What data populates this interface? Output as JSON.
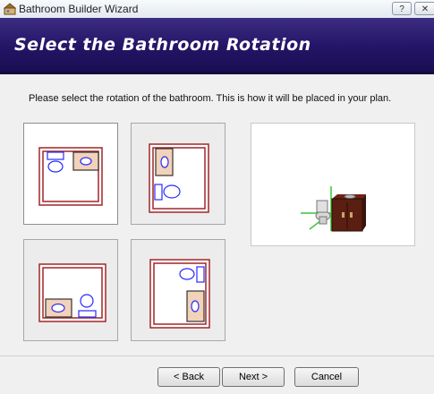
{
  "window": {
    "title": "Bathroom Builder Wizard",
    "help_glyph": "?",
    "close_glyph": "✕"
  },
  "banner": {
    "title": "Select the Bathroom Rotation"
  },
  "instruction": "Please select the rotation of the bathroom. This is how it will be placed in your plan.",
  "rotations": [
    {
      "id": "rotation-1",
      "selected": true
    },
    {
      "id": "rotation-2",
      "selected": false
    },
    {
      "id": "rotation-3",
      "selected": false
    },
    {
      "id": "rotation-4",
      "selected": false
    }
  ],
  "buttons": {
    "back": "< Back",
    "next": "Next >",
    "cancel": "Cancel"
  },
  "colors": {
    "banner": "#241466",
    "wall": "#a0262a",
    "fixture_fill": "#f2d2b8",
    "fixture_stroke": "#2a2aff"
  }
}
